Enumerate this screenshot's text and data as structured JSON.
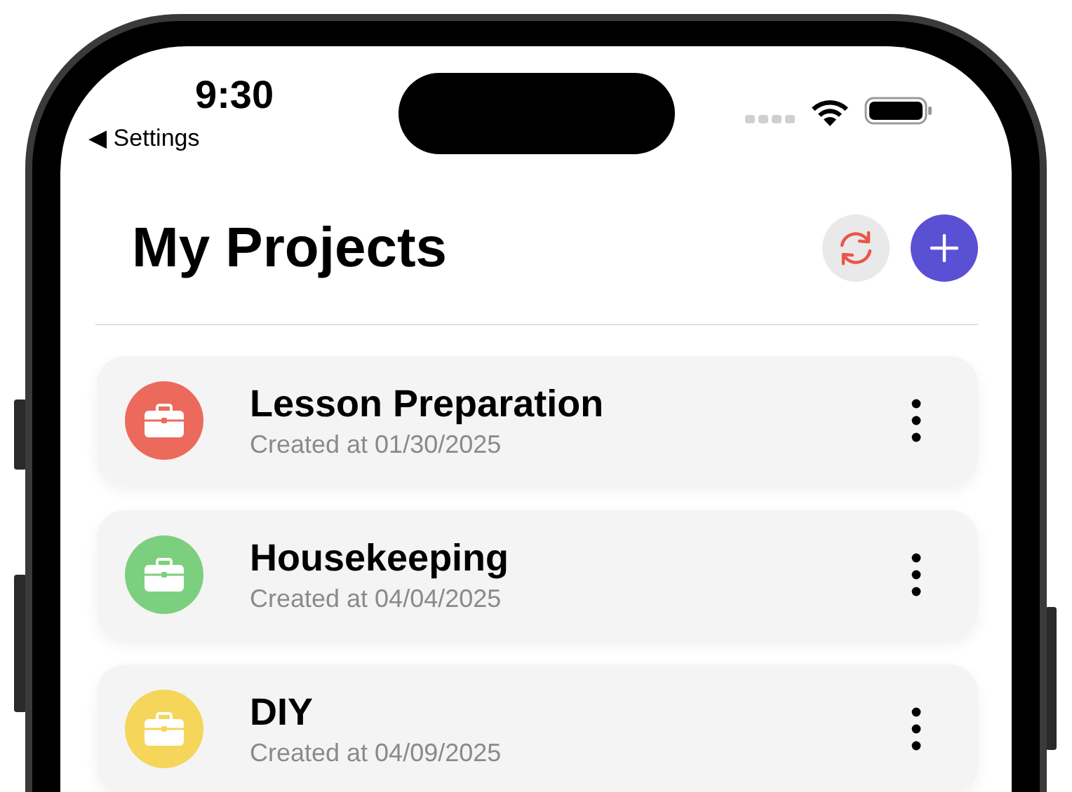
{
  "status_bar": {
    "time": "9:30",
    "back_label": "◀ Settings"
  },
  "header": {
    "title": "My Projects"
  },
  "projects": [
    {
      "name": "Lesson Preparation",
      "created": "Created at 01/30/2025",
      "color": "#ec6a5c"
    },
    {
      "name": "Housekeeping",
      "created": "Created at 04/04/2025",
      "color": "#7ccf7e"
    },
    {
      "name": "DIY",
      "created": "Created at 04/09/2025",
      "color": "#f5d55a"
    }
  ]
}
